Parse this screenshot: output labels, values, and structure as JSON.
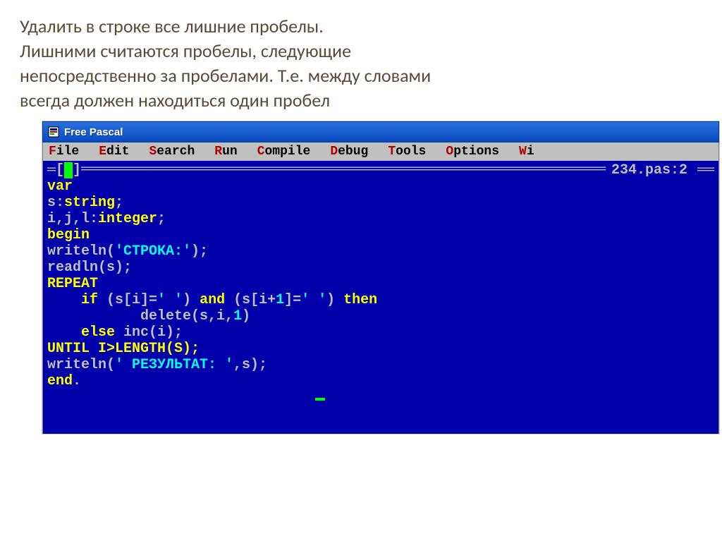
{
  "slide": {
    "title_line1": "Удалить в строке все лишние пробелы.",
    "title_line2": "Лишними считаются пробелы, следующие",
    "title_line3": "непосредственно за пробелами. Т.е. между словами",
    "title_line4": "всегда должен находиться один пробел"
  },
  "ide": {
    "window_title": "Free Pascal",
    "menus": [
      {
        "hotkey": "F",
        "rest": "ile"
      },
      {
        "hotkey": "E",
        "rest": "dit"
      },
      {
        "hotkey": "S",
        "rest": "earch"
      },
      {
        "hotkey": "R",
        "rest": "un"
      },
      {
        "hotkey": "C",
        "rest": "ompile"
      },
      {
        "hotkey": "D",
        "rest": "ebug"
      },
      {
        "hotkey": "T",
        "rest": "ools"
      },
      {
        "hotkey": "O",
        "rest": "ptions"
      },
      {
        "hotkey": "W",
        "rest": "i"
      }
    ],
    "topbar": {
      "left_marker": "═[",
      "square": "■",
      "left_close": "]",
      "filename": "234.pas:2",
      "right_eq": " ══"
    },
    "code": {
      "l1": {
        "a": "var"
      },
      "l2": {
        "a": "s:",
        "b": "string",
        "c": ";"
      },
      "l3": {
        "a": "i,j,l:",
        "b": "integer",
        "c": ";"
      },
      "l4": {
        "a": "begin"
      },
      "l5": {
        "a": "writeln(",
        "b": "'СТРОКА:'",
        "c": ");"
      },
      "l6": {
        "a": "readln(s);"
      },
      "l7": {
        "a": "REPEAT"
      },
      "l8": {
        "pad": "    ",
        "a": "if",
        "b": " (s[i]=",
        "c": "' '",
        "d": ") ",
        "e": "and",
        "f": " (s[i+",
        "g": "1",
        "h": "]=",
        "i": "' '",
        "j": ") ",
        "k": "then"
      },
      "l9": {
        "pad": "           ",
        "a": "delete(s,i,",
        "b": "1",
        "c": ")"
      },
      "l10": {
        "pad": "    ",
        "a": "else",
        "b": " inc(i);"
      },
      "l11": {
        "a": "UNTIL I>LENGTH(S);"
      },
      "l12": {
        "a": "writeln(",
        "b": "' РЕЗУЛЬТАТ: '",
        "c": ",s);"
      },
      "l13": {
        "a": "end",
        "b": "."
      }
    }
  }
}
